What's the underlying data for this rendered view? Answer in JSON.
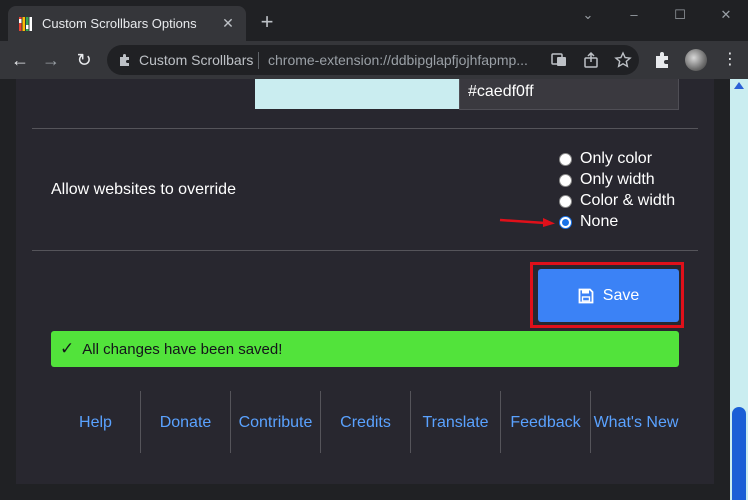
{
  "window": {
    "tab_title": "Custom Scrollbars Options",
    "tab_close": "✕",
    "new_tab": "+",
    "minimize": "⌄",
    "maximize": "–",
    "restore": "☐",
    "close": "✕"
  },
  "toolbar": {
    "back": "←",
    "forward": "→",
    "reload": "↻",
    "site_name": "Custom Scrollbars",
    "url": "chrome-extension://ddbipglapfjojhfapmp...",
    "menu": "⋮"
  },
  "options": {
    "color_value": "#caedf0ff",
    "override_label": "Allow websites to override",
    "override_options": [
      {
        "label": "Only color",
        "checked": false
      },
      {
        "label": "Only width",
        "checked": false
      },
      {
        "label": "Color & width",
        "checked": false
      },
      {
        "label": "None",
        "checked": true
      }
    ],
    "save_label": "Save",
    "status_check": "✓",
    "status_text": "All changes have been saved!"
  },
  "footer": {
    "links": [
      "Help",
      "Donate",
      "Contribute",
      "Credits",
      "Translate",
      "Feedback",
      "What's New"
    ]
  },
  "colors": {
    "swatch": "#caedf0",
    "save_button": "#3b82f6",
    "status_bg": "#52e33b",
    "highlight": "#e0101a",
    "link": "#5aa2ff"
  }
}
